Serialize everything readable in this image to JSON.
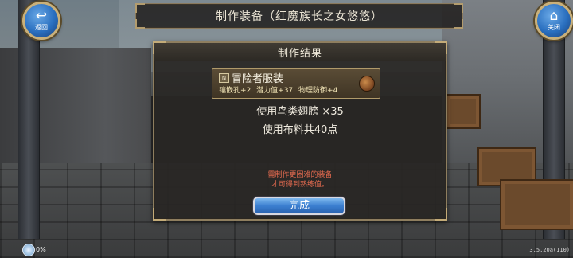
{
  "header": {
    "title": "制作装备（红魔族长之女悠悠）",
    "back_label": "返回",
    "close_label": "关闭"
  },
  "dialog": {
    "title": "制作结果",
    "item": {
      "grade_badge": "N",
      "name": "冒险者服装",
      "stats": [
        "镶嵌孔+2",
        "潜力值+37",
        "物理防御+4"
      ],
      "icon": "cloth-armor-icon"
    },
    "materials": [
      "使用鸟类翅膀 ×35",
      "使用布料共40点"
    ],
    "warning_lines": [
      "需制作更困难的装备",
      "才可得到熟练值。"
    ],
    "done_label": "完成"
  },
  "footer": {
    "status_percent": "0%",
    "version": "3.5.20a(110)"
  },
  "colors": {
    "accent_blue": "#3c7fd0",
    "frame_gold": "#8e7e5f",
    "warning_red": "#e36a4f"
  }
}
